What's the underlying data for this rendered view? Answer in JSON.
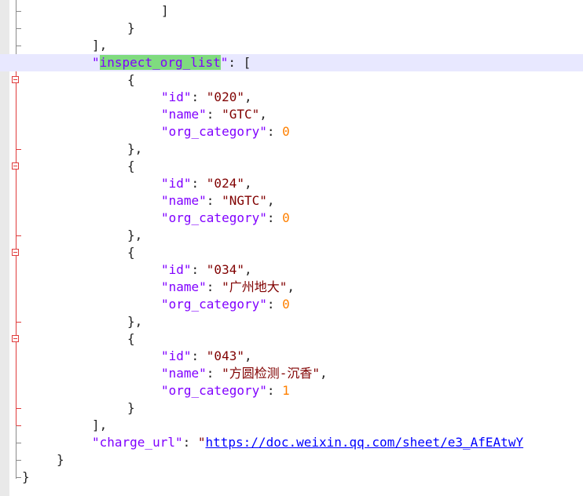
{
  "editor": {
    "language": "json",
    "current_line_highlight": "#e8e8ff",
    "match_highlight": "#7fdb7f",
    "colors": {
      "key": "#8000ff",
      "string": "#800000",
      "number": "#ff8000",
      "url": "#0000ff",
      "punctuation": "#222222",
      "fold_active": "#e03c3c"
    }
  },
  "code": {
    "array_close_inner": "]",
    "object_close_inner": "}",
    "array_close_outer": "],",
    "list_key": "\"inspect_org_list\"",
    "list_key_name": "inspect_org_list",
    "list_open": ": [",
    "object_open": "{",
    "object_close_comma": "},",
    "object_close": "}",
    "colon": ": ",
    "comma": ",",
    "quote": "\"",
    "id_key": "\"id\"",
    "name_key": "\"name\"",
    "category_key": "\"org_category\"",
    "items": [
      {
        "id": "\"020\"",
        "name": "\"GTC\"",
        "org_category": "0"
      },
      {
        "id": "\"024\"",
        "name": "\"NGTC\"",
        "org_category": "0"
      },
      {
        "id": "\"034\"",
        "name": "\"广州地大\"",
        "org_category": "0"
      },
      {
        "id": "\"043\"",
        "name": "\"方圆检测-沉香\"",
        "org_category": "1"
      }
    ],
    "charge_url_key": "\"charge_url\"",
    "charge_url_value": "https://doc.weixin.qq.com/sheet/e3_AfEAtwY",
    "parent_close": "}",
    "root_close": "}"
  }
}
